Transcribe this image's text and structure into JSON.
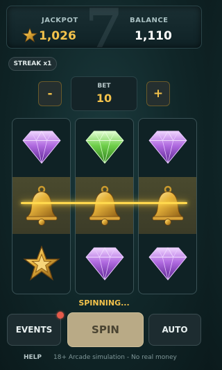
{
  "header": {
    "jackpot_label": "JACKPOT",
    "jackpot_value": "1,026",
    "balance_label": "BALANCE",
    "balance_value": "1,110",
    "background_glyph": "7"
  },
  "streak": {
    "label": "STREAK x1"
  },
  "bet": {
    "label": "BET",
    "value": "10",
    "minus_label": "-",
    "plus_label": "+"
  },
  "reels": [
    [
      "purple-diamond",
      "golden-bell",
      "gold-star"
    ],
    [
      "green-diamond",
      "golden-bell",
      "purple-diamond"
    ],
    [
      "purple-diamond",
      "golden-bell",
      "purple-diamond"
    ]
  ],
  "status": {
    "text": "SPINNING..."
  },
  "buttons": {
    "events_label": "EVENTS",
    "spin_label": "SPIN",
    "auto_label": "AUTO"
  },
  "footer": {
    "help_label": "HELP",
    "disclaimer": "18+ Arcade simulation - No real money"
  },
  "colors": {
    "accent_gold": "#f3c24b",
    "payline": "#ffd84d",
    "notification": "#e55a4a",
    "spin_button": "#b9aa86"
  }
}
